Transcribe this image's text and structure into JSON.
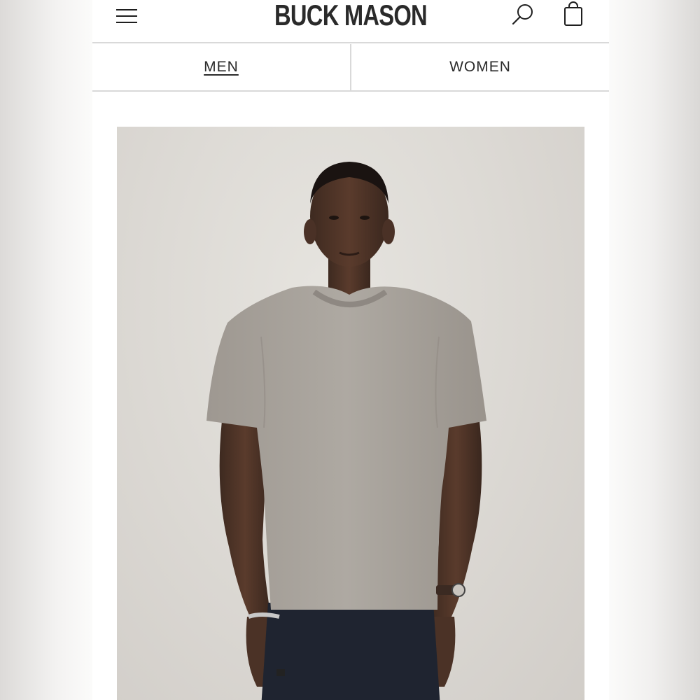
{
  "header": {
    "logo_text": "BUCK MASON",
    "menu_icon": "hamburger-menu-icon",
    "search_icon": "search-icon",
    "bag_icon": "shopping-bag-icon"
  },
  "tabs": [
    {
      "label": "MEN",
      "active": true
    },
    {
      "label": "WOMEN",
      "active": false
    }
  ],
  "colors": {
    "text": "#2a2a2a",
    "divider": "#d9d9d9",
    "hero_background": "#dcd9d4",
    "shirt": "#a8a39c",
    "jeans": "#1f2430"
  }
}
